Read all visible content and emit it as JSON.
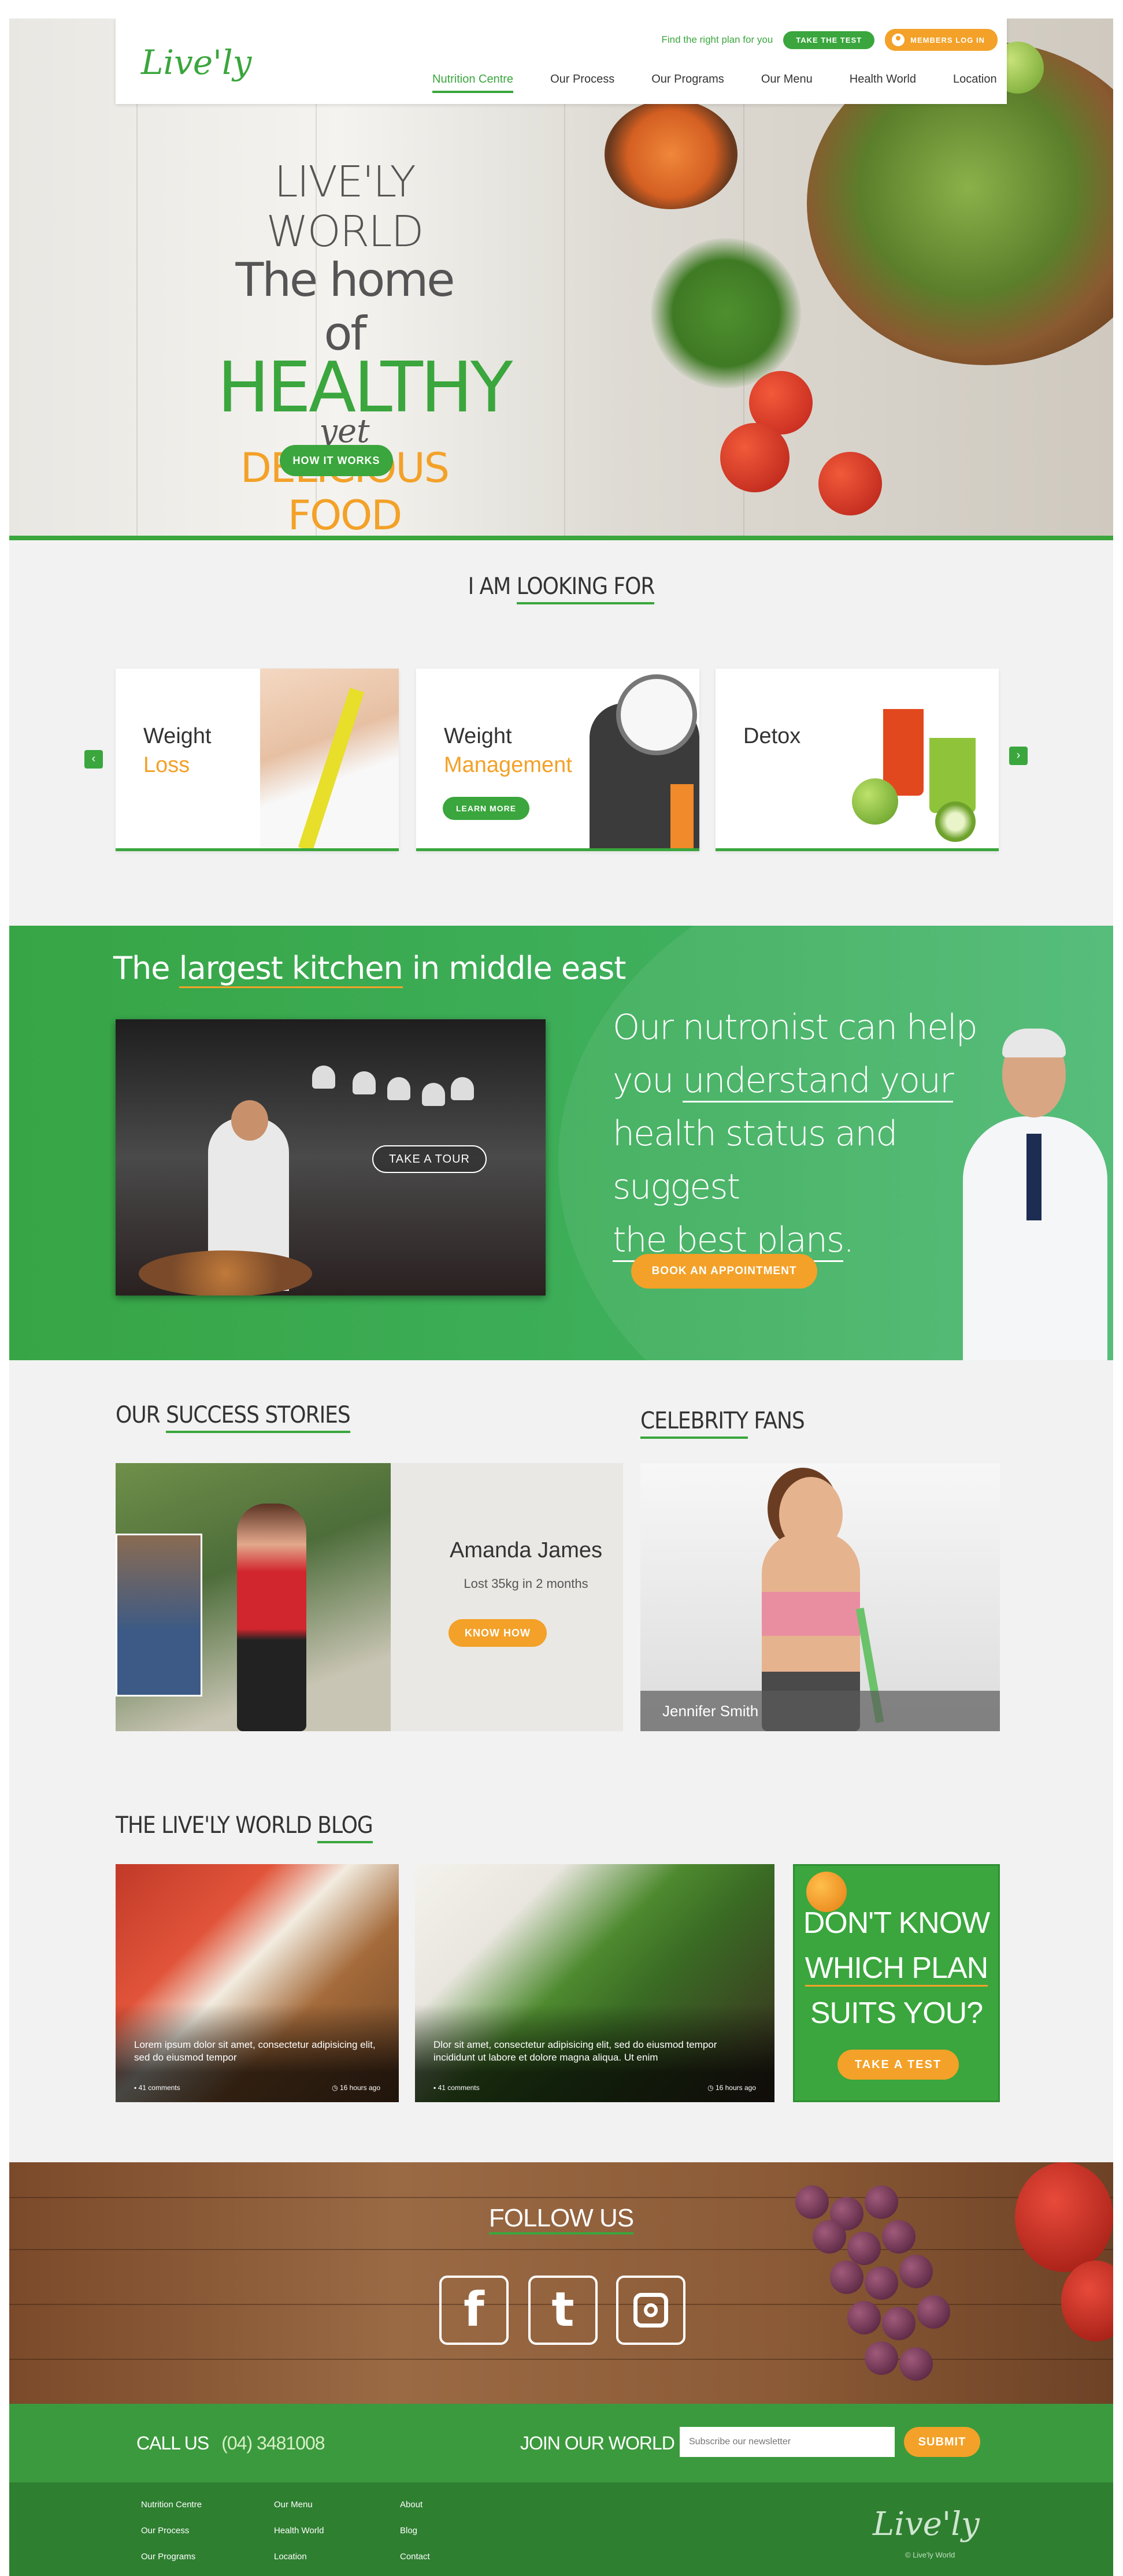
{
  "colors": {
    "brand_green": "#3aa63d",
    "brand_orange": "#f3a128"
  },
  "header": {
    "logo": "Live'ly",
    "tagline": "Find the right plan for you",
    "take_test": "TAKE THE TEST",
    "members_login": "MEMBERS LOG IN",
    "nav": [
      "Nutrition Centre",
      "Our Process",
      "Our Programs",
      "Our Menu",
      "Health World",
      "Location"
    ],
    "active_nav": "Nutrition Centre"
  },
  "hero": {
    "line1": "LIVE'LY WORLD",
    "line2": "The home of",
    "line3": "HEALTHY",
    "line4": "yet",
    "line5": "DELICIOUS FOOD",
    "button": "HOW IT WORKS"
  },
  "looking": {
    "title_a": "I AM ",
    "title_b": "LOOKING FOR",
    "cards": [
      {
        "t1": "Weight",
        "t2": "Loss"
      },
      {
        "t1": "Weight",
        "t2": "Management",
        "button": "LEARN MORE"
      },
      {
        "t1": "Detox",
        "t2": ""
      }
    ],
    "prev_icon": "chevron-left-icon",
    "next_icon": "chevron-right-icon"
  },
  "kitchen": {
    "title_a": "The ",
    "title_b": "largest kitchen",
    "title_c": " in middle east",
    "tour_button": "TAKE A TOUR"
  },
  "nutritionist": {
    "l1": "Our nutronist can help",
    "l2a": "you ",
    "l2b": "understand your",
    "l3": "health status and suggest",
    "l4a": "the best plans",
    "l4b": ".",
    "button": "BOOK AN APPOINTMENT"
  },
  "stories": {
    "title_a": "OUR ",
    "title_b": "SUCCESS STORIES",
    "name": "Amanda James",
    "result": "Lost 35kg in 2 months",
    "button": "KNOW HOW"
  },
  "celebrity": {
    "title_a": "CELEBRITY",
    "title_b": " FANS",
    "name": "Jennifer Smith"
  },
  "blog": {
    "title_a": "THE LIVE'LY WORLD ",
    "title_b": "BLOG",
    "posts": [
      {
        "text": "Lorem ipsum dolor sit amet, consectetur adipisicing elit, sed do eiusmod tempor",
        "comments": "41 comments",
        "time": "16 hours ago"
      },
      {
        "text": "Dlor sit amet, consectetur adipisicing elit, sed do eiusmod tempor incididunt ut labore et dolore magna aliqua. Ut enim",
        "comments": "41 comments",
        "time": "16 hours ago"
      }
    ],
    "plan": {
      "l1": "DON'T KNOW",
      "l2": "WHICH PLAN",
      "l3": "SUITS YOU?",
      "button": "TAKE A TEST"
    }
  },
  "follow": {
    "title": "FOLLOW US",
    "icons": [
      "facebook-icon",
      "twitter-icon",
      "instagram-icon"
    ]
  },
  "footer": {
    "call_label": "CALL US",
    "phone": "(04) 3481008",
    "join": "JOIN OUR WORLD",
    "newsletter_placeholder": "Subscribe our newsletter",
    "submit": "SUBMIT",
    "col1": [
      "Nutrition Centre",
      "Our Process",
      "Our Programs"
    ],
    "col2": [
      "Our Menu",
      "Health World",
      "Location"
    ],
    "col3": [
      "About",
      "Blog",
      "Contact"
    ],
    "logo": "Live'ly",
    "copyright": "© Live'ly World"
  }
}
